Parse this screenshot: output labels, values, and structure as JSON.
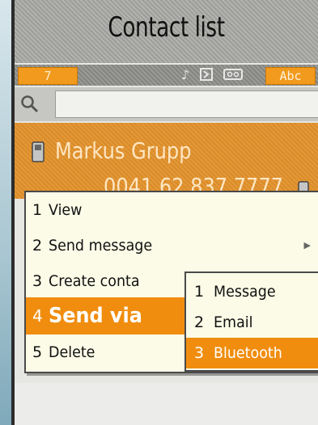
{
  "app": {
    "title": "Contact list"
  },
  "status": {
    "count": "7",
    "icons": [
      "music-note-icon",
      "memory-card-icon",
      "voicemail-icon"
    ],
    "input_mode": "Abc"
  },
  "search": {
    "value": ""
  },
  "contact": {
    "name": "Markus Grupp",
    "number": "0041 62 837 7777"
  },
  "context_menu": {
    "items": [
      {
        "num": "1",
        "label": "View"
      },
      {
        "num": "2",
        "label": "Send message"
      },
      {
        "num": "3",
        "label": "Create conta"
      },
      {
        "num": "4",
        "label": "Send via"
      },
      {
        "num": "5",
        "label": "Delete"
      }
    ],
    "selected_index": 3
  },
  "submenu": {
    "items": [
      {
        "num": "1",
        "label": "Message"
      },
      {
        "num": "2",
        "label": "Email"
      },
      {
        "num": "3",
        "label": "Bluetooth"
      }
    ],
    "selected_index": 2
  },
  "colors": {
    "accent": "#f08d0e",
    "menu_bg": "#fbfbe7",
    "titlebar": "#a7a7a4"
  }
}
